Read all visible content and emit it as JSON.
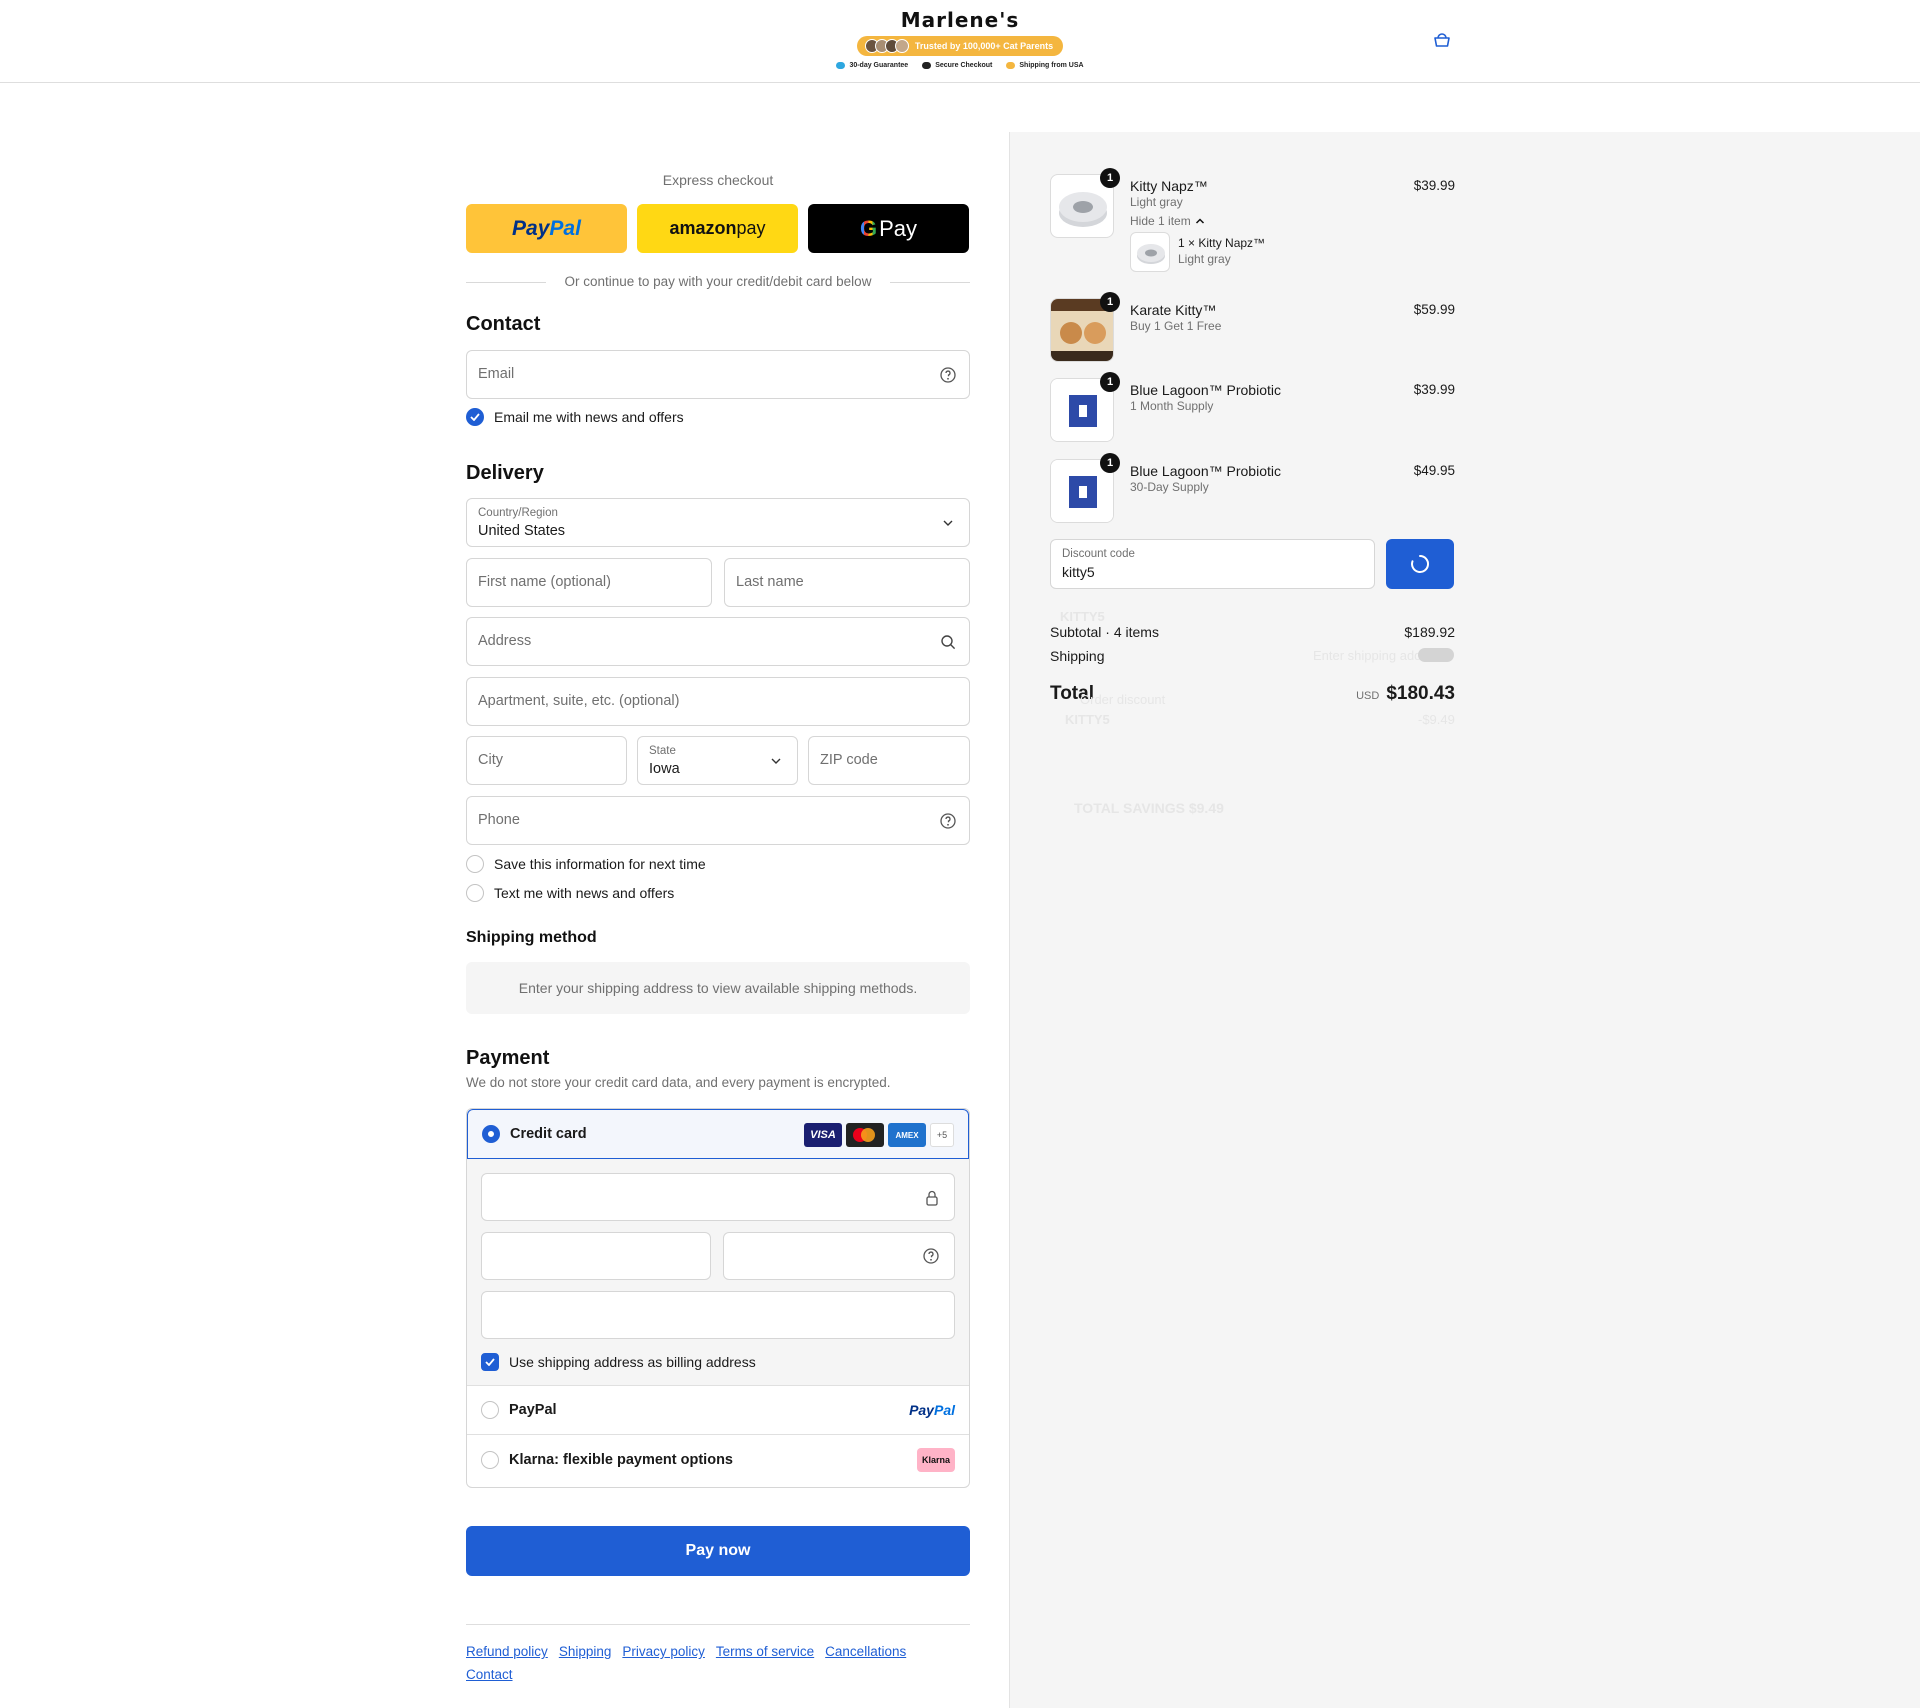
{
  "header": {
    "brand": "Marlene's",
    "trust_badge": "Trusted by 100,000+ Cat Parents",
    "guarantees": [
      "30-day Guarantee",
      "Secure Checkout",
      "Shipping from USA"
    ]
  },
  "express": {
    "title": "Express checkout",
    "paypal_a": "Pay",
    "paypal_b": "Pal",
    "amazon_a": "amazon",
    "amazon_b": " pay",
    "gpay_g": "G",
    "gpay_text": "Pay",
    "divider": "Or continue to pay with your credit/debit card below"
  },
  "contact": {
    "title": "Contact",
    "email_placeholder": "Email",
    "news_label": "Email me with news and offers",
    "news_checked": true
  },
  "delivery": {
    "title": "Delivery",
    "country_label": "Country/Region",
    "country_value": "United States",
    "first_name_placeholder": "First name (optional)",
    "last_name_placeholder": "Last name",
    "address_placeholder": "Address",
    "apartment_placeholder": "Apartment, suite, etc. (optional)",
    "city_placeholder": "City",
    "state_label": "State",
    "state_value": "Iowa",
    "zip_placeholder": "ZIP code",
    "phone_placeholder": "Phone",
    "save_info_label": "Save this information for next time",
    "text_offers_label": "Text me with news and offers"
  },
  "shipping_method": {
    "title": "Shipping method",
    "message": "Enter your shipping address to view available shipping methods."
  },
  "payment": {
    "title": "Payment",
    "subtitle": "We do not store your credit card data, and every payment is encrypted.",
    "credit_card_label": "Credit card",
    "card_badges": [
      "VISA",
      "",
      "AMEX",
      "+5"
    ],
    "billing_label": "Use shipping address as billing address",
    "paypal_label": "PayPal",
    "paypal_logo_a": "Pay",
    "paypal_logo_b": "Pal",
    "klarna_label": "Klarna: flexible payment options",
    "klarna_logo": "Klarna"
  },
  "pay_now": "Pay now",
  "footer_links": [
    "Refund policy",
    "Shipping",
    "Privacy policy",
    "Terms of service",
    "Cancellations",
    "Contact"
  ],
  "summary": {
    "items": [
      {
        "qty": "1",
        "name": "Kitty Napz™",
        "variant": "Light gray",
        "price": "$39.99",
        "toggle": "Hide 1 item",
        "sub_name": "1 × Kitty Napz™",
        "sub_variant": "Light gray"
      },
      {
        "qty": "1",
        "name": "Karate Kitty™",
        "variant": "Buy 1 Get 1 Free",
        "price": "$59.99"
      },
      {
        "qty": "1",
        "name": "Blue Lagoon™ Probiotic",
        "variant": "1 Month Supply",
        "price": "$39.99"
      },
      {
        "qty": "1",
        "name": "Blue Lagoon™ Probiotic",
        "variant": "30-Day Supply",
        "price": "$49.95"
      }
    ],
    "discount_label": "Discount code",
    "discount_value": "kitty5",
    "subtotal_label": "Subtotal · 4 items",
    "subtotal_value": "$189.92",
    "shipping_label": "Shipping",
    "total_label": "Total",
    "currency": "USD",
    "total_value": "$180.43",
    "ghost_code": "KITTY5",
    "ghost_shipping": "Enter shipping address",
    "ghost_discount": "Order discount",
    "ghost_discount_value": "-$9.49",
    "ghost_savings": "TOTAL SAVINGS $9.49"
  },
  "colors": {
    "accent": "#1f5ed4",
    "paypal": "#ffc439",
    "amazon": "#ffd814",
    "klarna": "#ffb3c7"
  }
}
